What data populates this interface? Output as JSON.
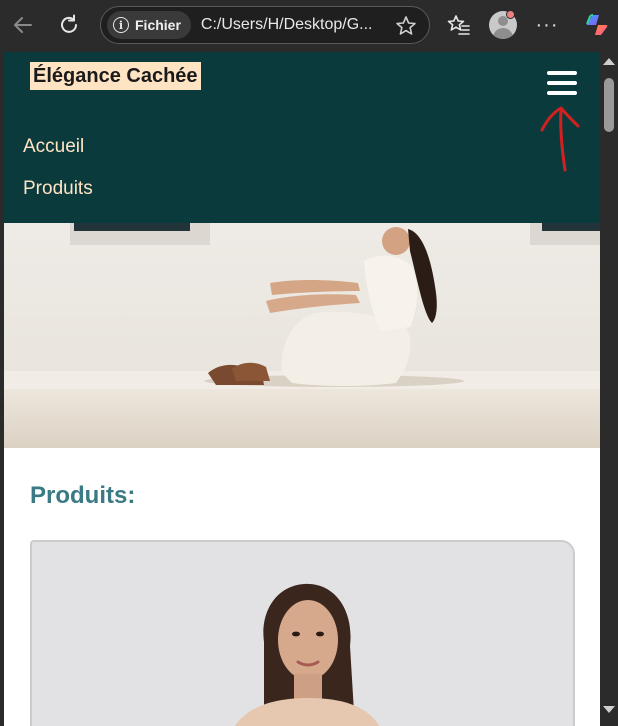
{
  "browser": {
    "site_chip_label": "Fichier",
    "url": "C:/Users/H/Desktop/G...",
    "icons": {
      "back": "arrow-left-icon",
      "reload": "reload-icon",
      "info": "info-icon",
      "favorite": "star-icon",
      "favorites": "favorites-icon",
      "profile": "profile-avatar",
      "more": "more-icon",
      "copilot": "copilot-icon"
    },
    "colors": {
      "chrome": "#2b2b2b",
      "profile_dot": "#f08080"
    }
  },
  "site": {
    "brand": "Élégance Cachée",
    "menu_icon": "hamburger-icon",
    "nav": {
      "accueil": "Accueil",
      "produits": "Produits"
    },
    "colors": {
      "header": "#0b3a3c",
      "brand_bg": "#ffe4c4",
      "nav_text": "#ffe4c4",
      "section_title": "#3a7a84"
    }
  },
  "products": {
    "section_title": "Produits:"
  }
}
